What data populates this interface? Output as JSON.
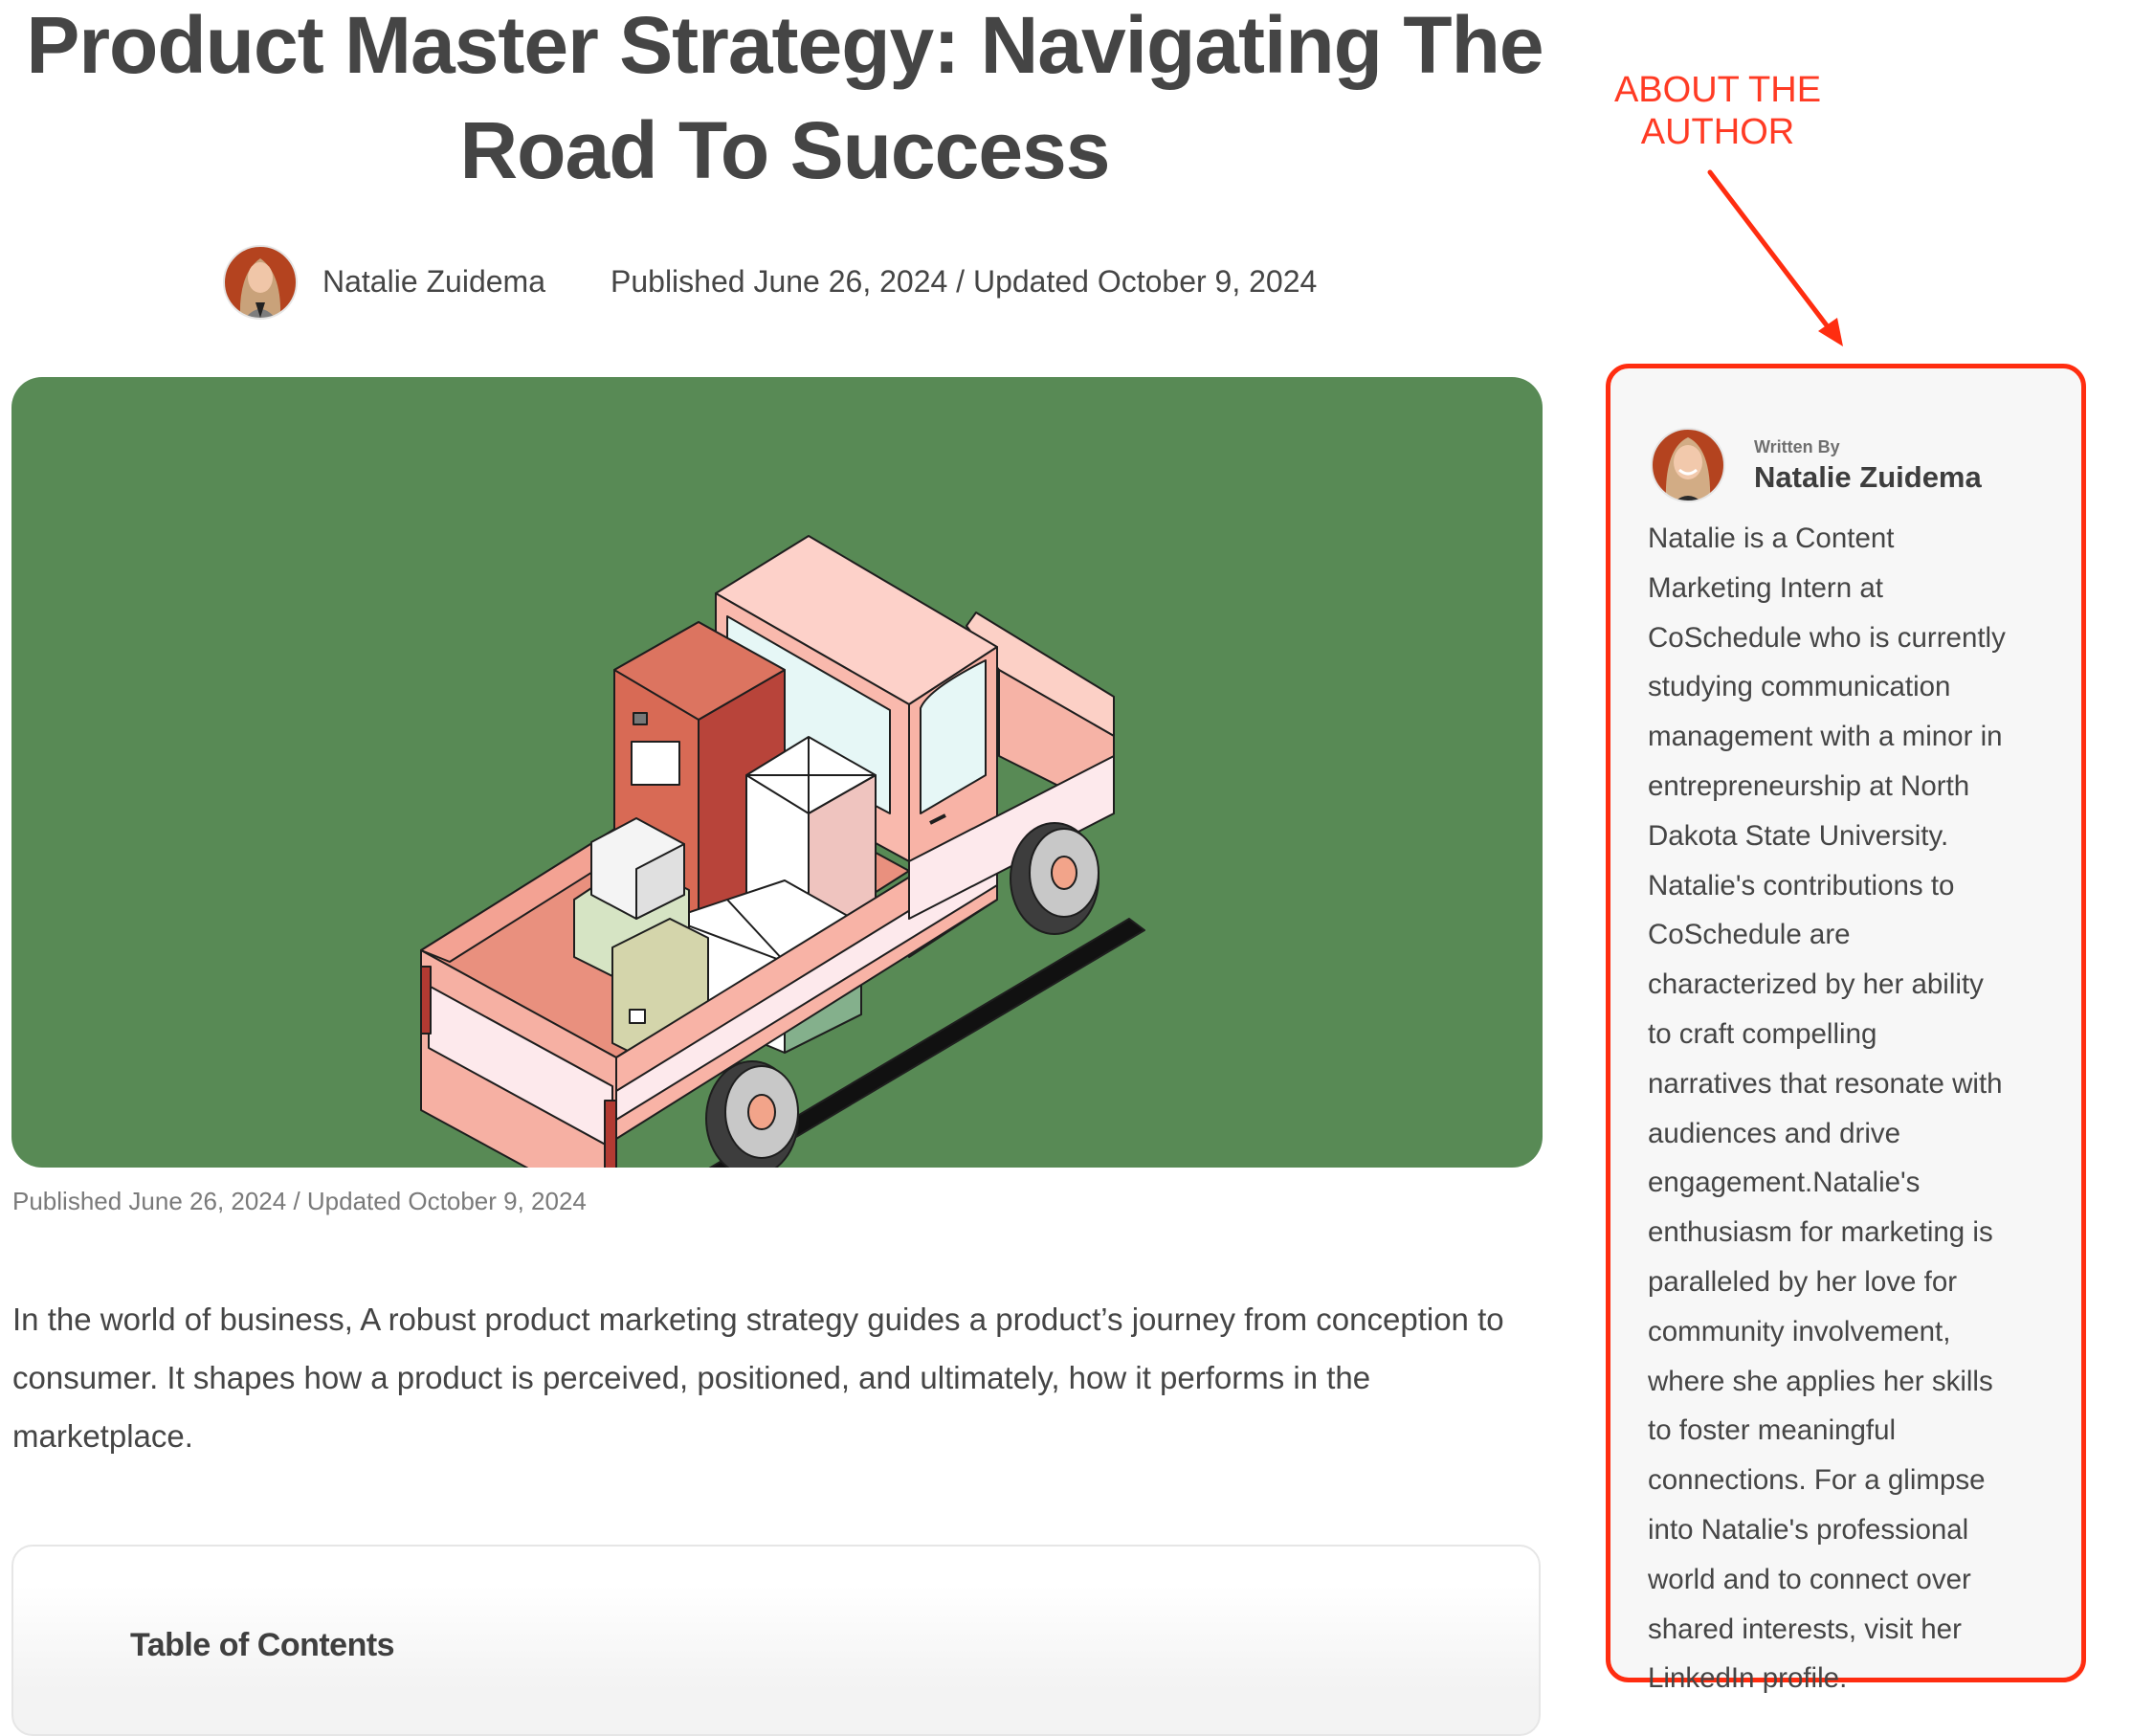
{
  "article": {
    "title": "Product Master Strategy: Navigating The Road To Success",
    "author_name": "Natalie Zuidema",
    "dates": "Published June 26, 2024 / Updated October 9, 2024",
    "hero_image_alt": "Illustration of a pink pickup truck loaded with boxes on a green background",
    "hero_background_color": "#588a55",
    "caption": "Published June 26, 2024 / Updated October 9, 2024",
    "intro": "In the world of business, A robust product marketing strategy guides a product’s journey from conception to consumer. It shapes how a product is perceived, positioned, and ultimately, how it performs in the marketplace.",
    "toc_title": "Table of Contents"
  },
  "annotation": {
    "label_line1": "ABOUT THE",
    "label_line2": "AUTHOR",
    "color": "#ff2d10"
  },
  "author_card": {
    "written_by": "Written By",
    "name": "Natalie Zuidema",
    "bio_lines": [
      "Natalie is a Content",
      "Marketing Intern at",
      "CoSchedule who is currently",
      "studying communication",
      "management with a minor in",
      "entrepreneurship at North",
      "Dakota State University.",
      "Natalie's contributions to",
      "CoSchedule are",
      "characterized by her ability",
      "to craft compelling",
      "narratives that resonate with",
      "audiences and drive",
      "engagement.Natalie's",
      "enthusiasm for marketing is",
      "paralleled by her love for",
      "community involvement,",
      "where she applies her skills",
      "to foster meaningful",
      "connections. For a glimpse",
      "into Natalie's professional",
      "world and to connect over",
      "shared interests, visit her",
      "LinkedIn profile."
    ],
    "background_color": "#f7f7f7"
  }
}
